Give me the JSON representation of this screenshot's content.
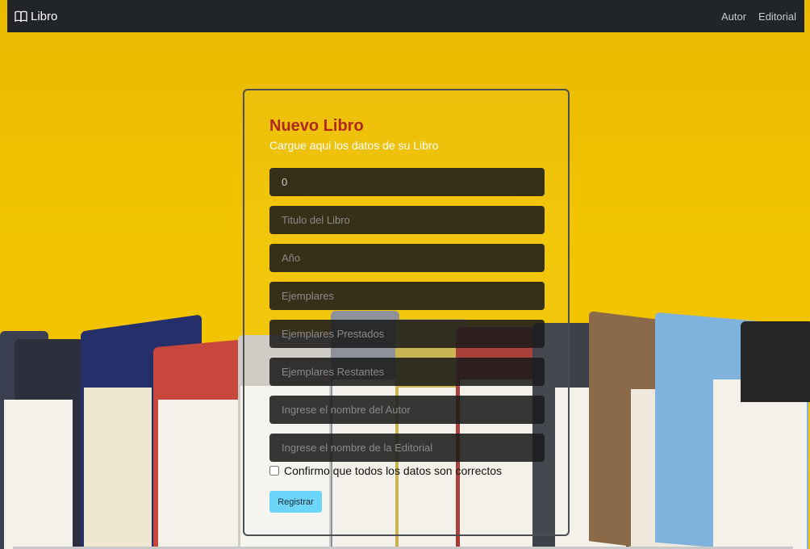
{
  "navbar": {
    "brand": "Libro",
    "links": [
      "Autor",
      "Editorial"
    ]
  },
  "form": {
    "title": "Nuevo Libro",
    "subtitle": "Cargue aqui los datos de su Libro",
    "fields": [
      {
        "value": "0",
        "placeholder": ""
      },
      {
        "value": "",
        "placeholder": "Titulo del Libro"
      },
      {
        "value": "",
        "placeholder": "Año"
      },
      {
        "value": "",
        "placeholder": "Ejemplares"
      },
      {
        "value": "",
        "placeholder": "Ejemplares Prestados"
      },
      {
        "value": "",
        "placeholder": "Ejemplares Restantes"
      },
      {
        "value": "",
        "placeholder": "Ingrese el nombre del Autor"
      },
      {
        "value": "",
        "placeholder": "Ingrese el nombre de la Editorial"
      }
    ],
    "checkbox_label": "Confirmo que todos los datos son correctos",
    "submit_label": "Registrar"
  },
  "colors": {
    "navbar_bg": "#212529",
    "title": "#b0291f",
    "button": "#6dd5fa",
    "background": "#f0c419"
  },
  "icons": {
    "brand": "book-open-icon"
  }
}
